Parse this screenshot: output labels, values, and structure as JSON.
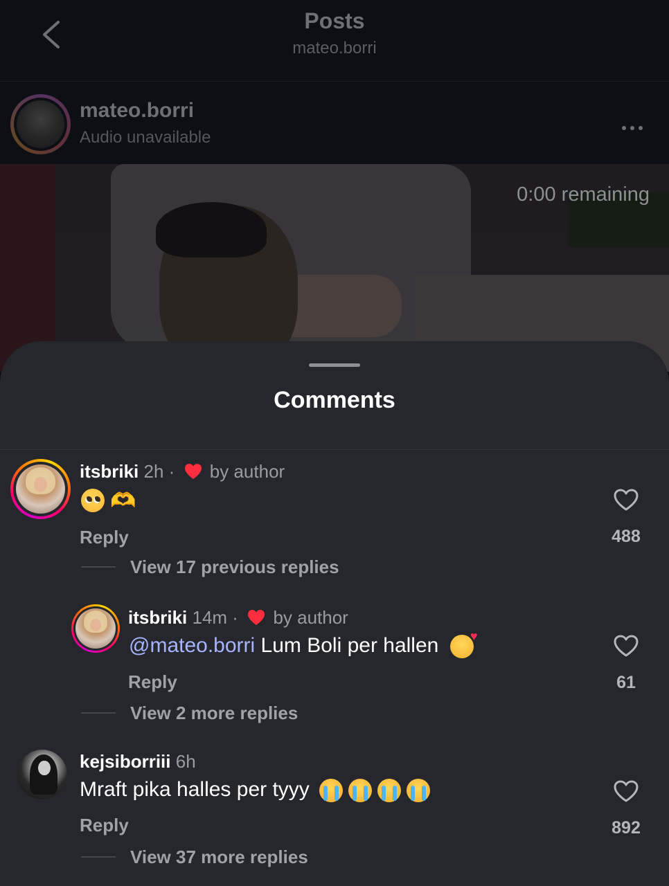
{
  "header": {
    "title": "Posts",
    "subtitle": "mateo.borri"
  },
  "post": {
    "author": "mateo.borri",
    "audio_status": "Audio unavailable",
    "remaining": "0:00 remaining"
  },
  "sheet": {
    "title": "Comments"
  },
  "comments": [
    {
      "username": "itsbriki",
      "time": "2h",
      "dot": "·",
      "liked_by": "by author",
      "text": "",
      "emojis": [
        "pleading-face",
        "heart-hands"
      ],
      "reply_label": "Reply",
      "likes": "488",
      "view_replies": "View 17 previous replies"
    },
    {
      "username": "itsbriki",
      "time": "14m",
      "dot": "·",
      "liked_by": "by author",
      "mention": "@mateo.borri",
      "text": " Lum Boli per hallen",
      "emojis": [
        "smiling-face-with-hearts"
      ],
      "reply_label": "Reply",
      "likes": "61",
      "view_replies": "View 2 more replies"
    },
    {
      "username": "kejsiborriii",
      "time": "6h",
      "text": "Mraft pika halles per tyyy",
      "emojis": [
        "loudly-crying-face",
        "loudly-crying-face",
        "loudly-crying-face",
        "loudly-crying-face"
      ],
      "reply_label": "Reply",
      "likes": "892",
      "view_replies": "View 37 more replies"
    }
  ],
  "colors": {
    "accent_mention": "#a6b4ff",
    "heart_red": "#ff2d3d",
    "sheet_bg": "#25272d"
  }
}
